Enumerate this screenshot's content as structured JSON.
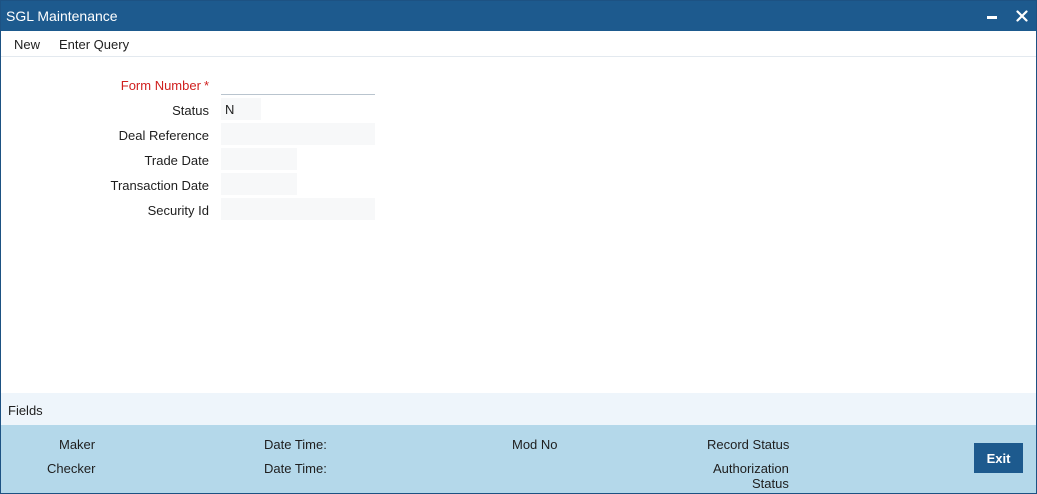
{
  "window": {
    "title": "SGL Maintenance",
    "minimize_glyph": "▬",
    "close_glyph": "✕"
  },
  "toolbar": {
    "new_label": "New",
    "enter_query_label": "Enter Query"
  },
  "form": {
    "form_number": {
      "label": "Form Number",
      "required_mark": "*",
      "value": ""
    },
    "status": {
      "label": "Status",
      "value": "N"
    },
    "deal_reference": {
      "label": "Deal Reference",
      "value": ""
    },
    "trade_date": {
      "label": "Trade Date",
      "value": ""
    },
    "transaction_date": {
      "label": "Transaction Date",
      "value": ""
    },
    "security_id": {
      "label": "Security Id",
      "value": ""
    }
  },
  "fields_bar": {
    "label": "Fields"
  },
  "audit": {
    "maker_label": "Maker",
    "checker_label": "Checker",
    "maker_datetime_label": "Date Time:",
    "checker_datetime_label": "Date Time:",
    "mod_no_label": "Mod No",
    "record_status_label": "Record Status",
    "authorization_label_line1": "Authorization",
    "authorization_label_line2": "Status"
  },
  "buttons": {
    "exit_label": "Exit"
  },
  "colors": {
    "title_bar": "#1d5a8e",
    "audit_bar": "#b4d8ea",
    "fields_bar": "#eef5fb",
    "required": "#d0201f"
  }
}
